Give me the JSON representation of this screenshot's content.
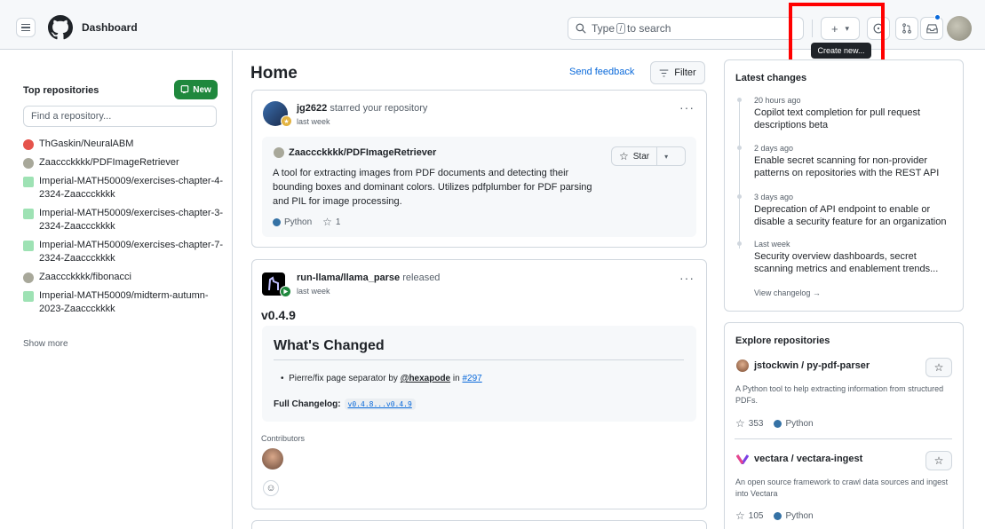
{
  "header": {
    "title": "Dashboard",
    "search_prefix": "Type",
    "search_key": "/",
    "search_suffix": "to search",
    "tooltip": "Create new...",
    "plus": "+",
    "caret": "▾"
  },
  "sidebar": {
    "heading": "Top repositories",
    "new_label": "New",
    "find_placeholder": "Find a repository...",
    "repos": [
      {
        "name": "ThGaskin/NeuralABM",
        "color": "#e5534b"
      },
      {
        "name": "Zaaccckkkk/PDFImageRetriever",
        "color": "#a8a89a"
      },
      {
        "name": "Imperial-MATH50009/exercises-chapter-4-2324-Zaaccckkkk",
        "color": "#9ee2b4"
      },
      {
        "name": "Imperial-MATH50009/exercises-chapter-3-2324-Zaaccckkkk",
        "color": "#9ee2b4"
      },
      {
        "name": "Imperial-MATH50009/exercises-chapter-7-2324-Zaaccckkkk",
        "color": "#9ee2b4"
      },
      {
        "name": "Zaaccckkkk/fibonacci",
        "color": "#a8a89a"
      },
      {
        "name": "Imperial-MATH50009/midterm-autumn-2023-Zaaccckkkk",
        "color": "#9ee2b4"
      }
    ],
    "show_more": "Show more"
  },
  "main": {
    "title": "Home",
    "send_feedback": "Send feedback",
    "filter": "Filter",
    "event1": {
      "actor": "jg2622",
      "action": "starred your repository",
      "time": "last week",
      "repo": "Zaaccckkkk/PDFImageRetriever",
      "desc": "A tool for extracting images from PDF documents and detecting their bounding boxes and dominant colors. Utilizes pdfplumber for PDF parsing and PIL for image processing.",
      "star_label": "Star",
      "language": "Python",
      "stars": "1"
    },
    "event2": {
      "repo": "run-llama/llama_parse",
      "action": "released",
      "time": "last week",
      "version": "v0.4.9",
      "changes_title": "What's Changed",
      "change_text": "Pierre/fix page separator by",
      "change_user": "@hexapode",
      "change_in": "in",
      "change_pr": "#297",
      "full_changelog_label": "Full Changelog:",
      "full_changelog_value": "v0.4.8...v0.4.9",
      "contributors": "Contributors"
    }
  },
  "latest": {
    "heading": "Latest changes",
    "items": [
      {
        "time": "20 hours ago",
        "text": "Copilot text completion for pull request descriptions beta"
      },
      {
        "time": "2 days ago",
        "text": "Enable secret scanning for non-provider patterns on repositories with the REST API"
      },
      {
        "time": "3 days ago",
        "text": "Deprecation of API endpoint to enable or disable a security feature for an organization"
      },
      {
        "time": "Last week",
        "text": "Security overview dashboards, secret scanning metrics and enablement trends..."
      }
    ],
    "view_changelog": "View changelog →"
  },
  "explore": {
    "heading": "Explore repositories",
    "repos": [
      {
        "name": "jstockwin / py-pdf-parser",
        "desc": "A Python tool to help extracting information from structured PDFs.",
        "stars": "353",
        "language": "Python"
      },
      {
        "name": "vectara / vectara-ingest",
        "desc": "An open source framework to crawl data sources and ingest into Vectara",
        "stars": "105",
        "language": "Python"
      }
    ]
  }
}
